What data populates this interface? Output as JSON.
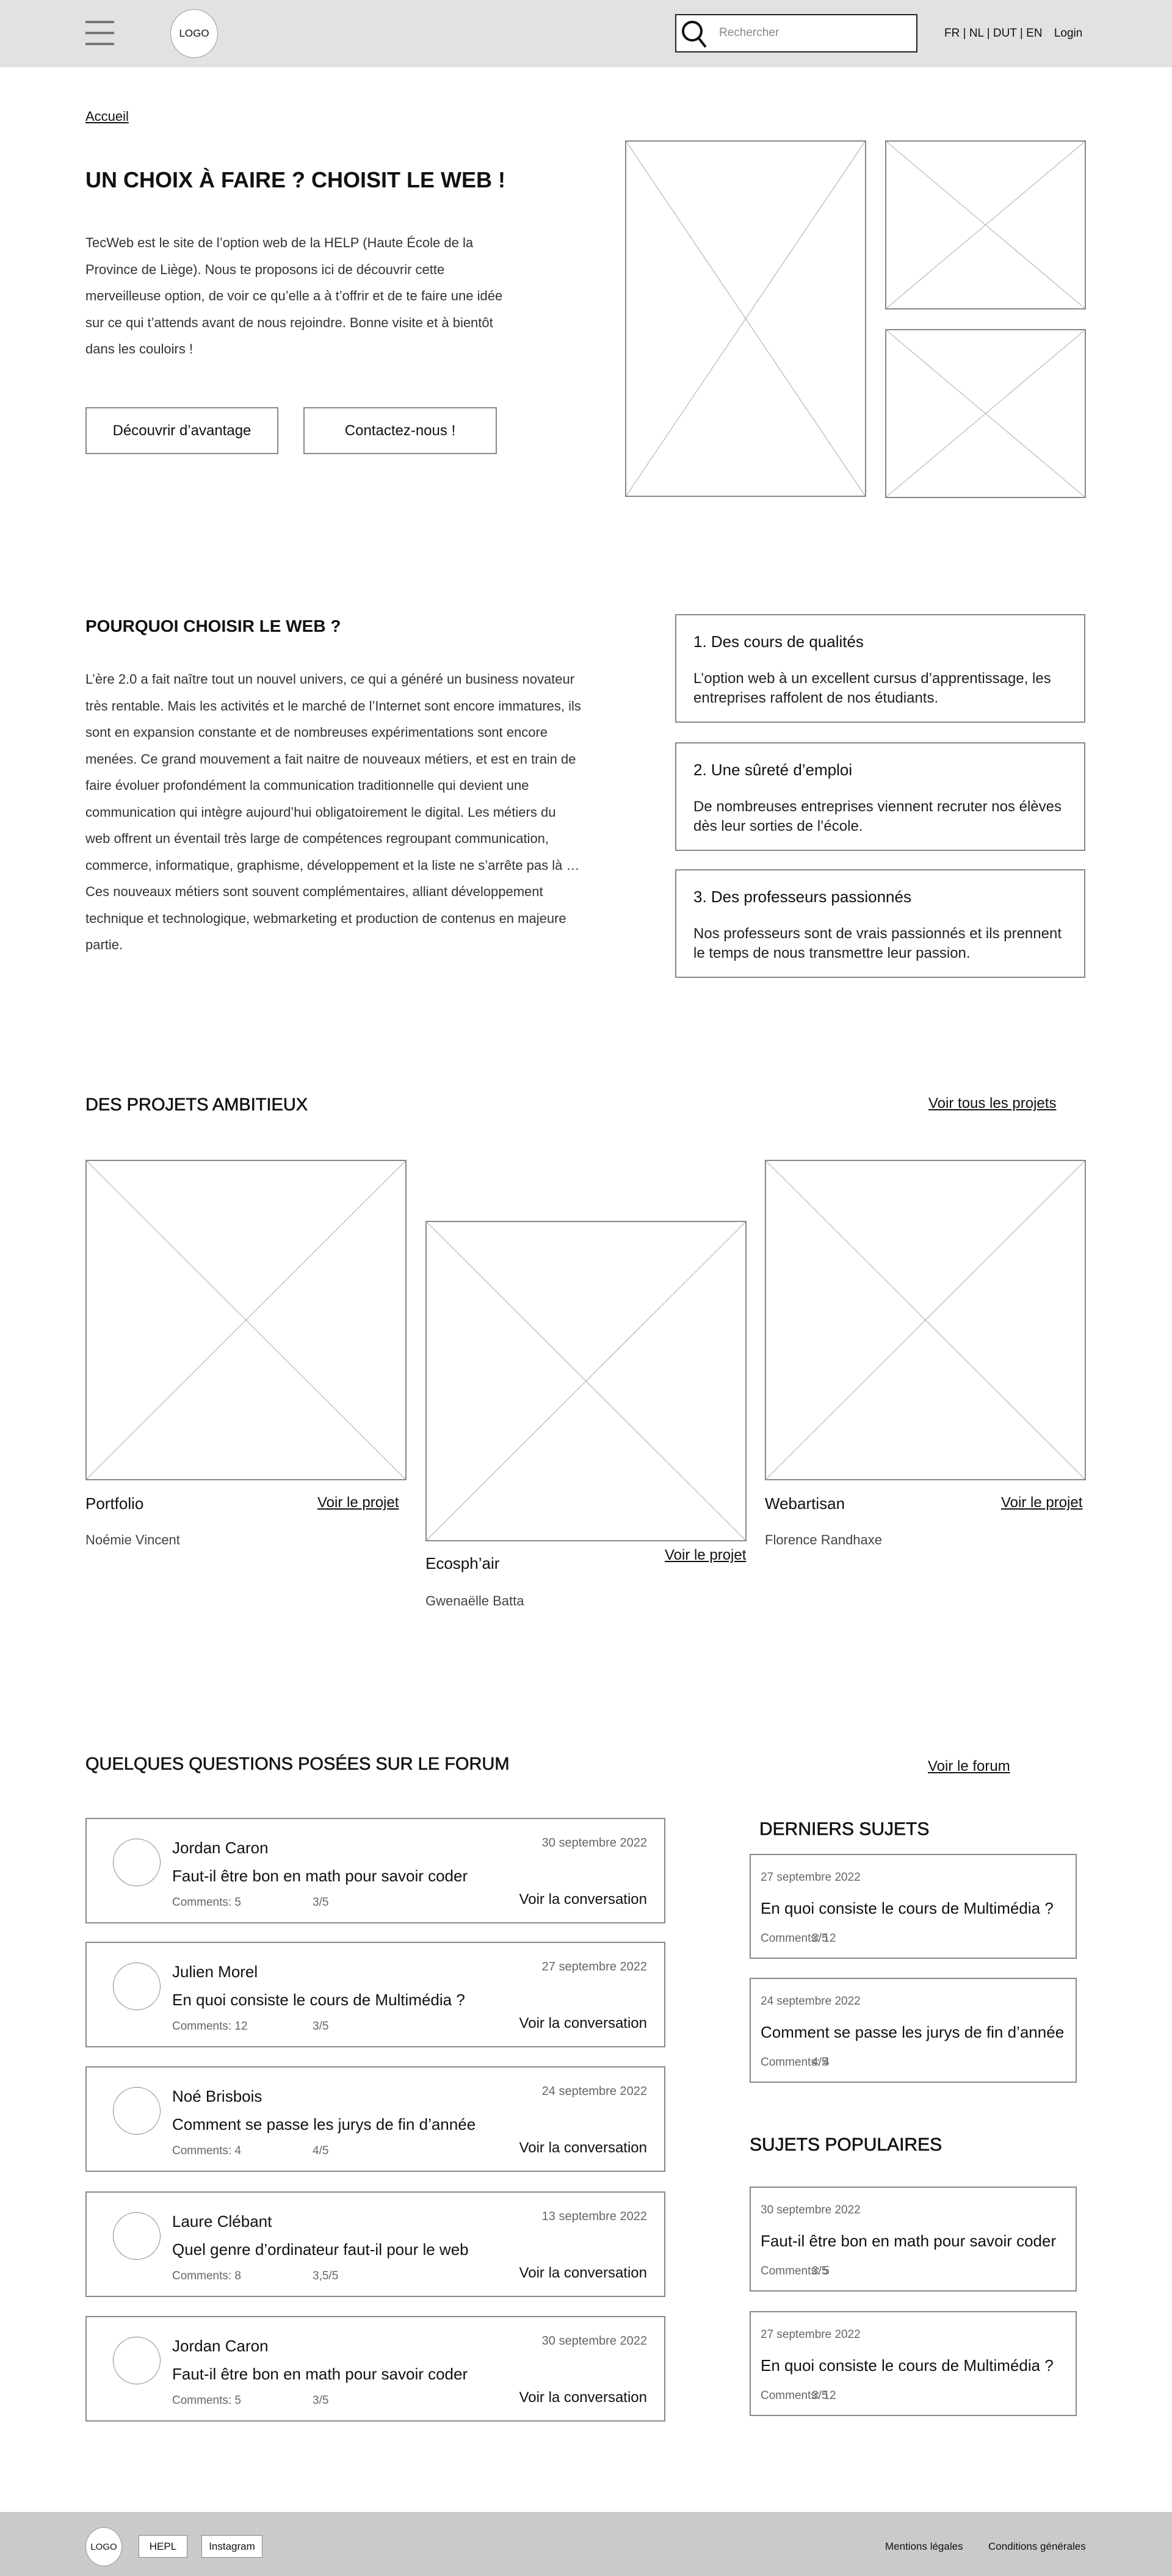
{
  "header": {
    "logo": "LOGO",
    "search_placeholder": "Rechercher",
    "languages": [
      "FR",
      "NL",
      "DUT",
      "EN"
    ],
    "login": "Login"
  },
  "breadcrumb": "Accueil",
  "hero": {
    "title": "UN CHOIX À FAIRE ? CHOISIT LE WEB !",
    "text": "TecWeb est le site de l’option web de la HELP (Haute École de la Province de Liège). Nous te proposons ici de découvrir cette merveilleuse option, de voir ce qu’elle a à t’offrir et de te faire une idée sur ce qui t’attends avant de nous rejoindre. Bonne visite et à bientôt dans les couloirs !",
    "btn_discover": "Découvrir d’avantage",
    "btn_contact": "Contactez-nous !"
  },
  "why": {
    "title": "POURQUOI CHOISIR LE WEB ?",
    "text": "L’ère 2.0 a fait naître tout un nouvel univers, ce qui a généré un business novateur très rentable. Mais les activités et le marché de l’Internet sont encore immatures, ils sont en expansion constante et de nombreuses expérimentations sont encore menées. Ce grand mouvement a fait naitre de nouveaux métiers, et est en train de faire évoluer profondément la communication traditionnelle qui devient une communication qui intègre aujourd’hui obligatoirement le digital. Les métiers du web offrent un éventail très large de compétences regroupant communication, commerce, informatique, graphisme, développement et la liste ne s’arrête pas là … Ces nouveaux métiers sont souvent complémentaires, alliant développement technique et technologique, webmarketing et production de contenus en majeure partie.",
    "cards": [
      {
        "title": "1. Des cours de qualités",
        "text": "L’option web à un excellent cursus d’apprentissage, les entreprises raffolent de nos étudiants."
      },
      {
        "title": "2. Une sûreté d’emploi",
        "text": "De nombreuses entreprises viennent recruter nos élèves dès leur sorties de l’école."
      },
      {
        "title": "3. Des professeurs passionnés",
        "text": "Nos professeurs sont de vrais passionnés et ils prennent le temps de nous transmettre leur passion."
      }
    ]
  },
  "projects": {
    "title": "DES PROJETS AMBITIEUX",
    "see_all": "Voir tous les projets",
    "items": [
      {
        "title": "Portfolio",
        "author": "Noémie Vincent",
        "link": "Voir le projet"
      },
      {
        "title": "Ecosph’air",
        "author": "Gwenaëlle Batta",
        "link": "Voir le projet"
      },
      {
        "title": "Webartisan",
        "author": "Florence Randhaxe",
        "link": "Voir le projet"
      }
    ]
  },
  "forum": {
    "title": "QUELQUES QUESTIONS POSÉES SUR LE FORUM",
    "see_forum": "Voir le forum",
    "posts": [
      {
        "name": "Jordan Caron",
        "date": "30 septembre 2022",
        "title": "Faut-il être bon en math pour savoir coder",
        "comments": "Comments: 5",
        "rating": "3/5",
        "link": "Voir la conversation"
      },
      {
        "name": "Julien Morel",
        "date": "27 septembre 2022",
        "title": "En quoi consiste le cours de Multimédia ?",
        "comments": "Comments: 12",
        "rating": "3/5",
        "link": "Voir la conversation"
      },
      {
        "name": "Noé Brisbois",
        "date": "24 septembre 2022",
        "title": "Comment se passe les jurys de fin d’année",
        "comments": "Comments: 4",
        "rating": "4/5",
        "link": "Voir la conversation"
      },
      {
        "name": "Laure Clébant",
        "date": "13 septembre 2022",
        "title": "Quel genre d’ordinateur faut-il pour le web",
        "comments": "Comments: 8",
        "rating": "3,5/5",
        "link": "Voir la conversation"
      },
      {
        "name": "Jordan Caron",
        "date": "30 septembre 2022",
        "title": "Faut-il être bon en math pour savoir coder",
        "comments": "Comments: 5",
        "rating": "3/5",
        "link": "Voir la conversation"
      }
    ],
    "latest_title": "DERNIERS SUJETS",
    "latest": [
      {
        "date": "27 septembre 2022",
        "title": "En quoi consiste le cours de Multimédia ?",
        "comments": "Comments: 12",
        "rating": "3/5"
      },
      {
        "date": "24 septembre 2022",
        "title": "Comment se passe les jurys de fin d’année",
        "comments": "Comments: 4",
        "rating": "4/5"
      }
    ],
    "popular_title": "SUJETS POPULAIRES",
    "popular": [
      {
        "date": "30 septembre 2022",
        "title": "Faut-il être bon en math pour savoir coder",
        "comments": "Comments: 5",
        "rating": "3/5"
      },
      {
        "date": "27 septembre 2022",
        "title": "En quoi consiste le cours de Multimédia ?",
        "comments": "Comments: 12",
        "rating": "3/5"
      }
    ]
  },
  "footer": {
    "logo": "LOGO",
    "hepl": "HEPL",
    "instagram": "Instagram",
    "legal": "Mentions légales",
    "terms": "Conditions générales"
  }
}
